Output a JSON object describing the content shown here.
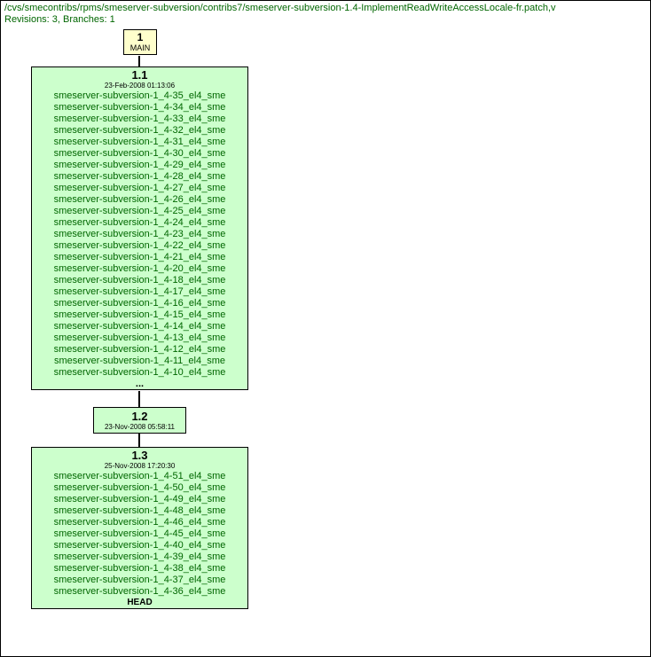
{
  "header": {
    "path": "/cvs/smecontribs/rpms/smeserver-subversion/contribs7/smeserver-subversion-1.4-ImplementReadWriteAccessLocale-fr.patch,v",
    "meta": "Revisions: 3, Branches: 1"
  },
  "branch": {
    "num": "1",
    "name": "MAIN"
  },
  "rev1": {
    "num": "1.1",
    "date": "23-Feb-2008 01:13:06",
    "tags": [
      "smeserver-subversion-1_4-35_el4_sme",
      "smeserver-subversion-1_4-34_el4_sme",
      "smeserver-subversion-1_4-33_el4_sme",
      "smeserver-subversion-1_4-32_el4_sme",
      "smeserver-subversion-1_4-31_el4_sme",
      "smeserver-subversion-1_4-30_el4_sme",
      "smeserver-subversion-1_4-29_el4_sme",
      "smeserver-subversion-1_4-28_el4_sme",
      "smeserver-subversion-1_4-27_el4_sme",
      "smeserver-subversion-1_4-26_el4_sme",
      "smeserver-subversion-1_4-25_el4_sme",
      "smeserver-subversion-1_4-24_el4_sme",
      "smeserver-subversion-1_4-23_el4_sme",
      "smeserver-subversion-1_4-22_el4_sme",
      "smeserver-subversion-1_4-21_el4_sme",
      "smeserver-subversion-1_4-20_el4_sme",
      "smeserver-subversion-1_4-18_el4_sme",
      "smeserver-subversion-1_4-17_el4_sme",
      "smeserver-subversion-1_4-16_el4_sme",
      "smeserver-subversion-1_4-15_el4_sme",
      "smeserver-subversion-1_4-14_el4_sme",
      "smeserver-subversion-1_4-13_el4_sme",
      "smeserver-subversion-1_4-12_el4_sme",
      "smeserver-subversion-1_4-11_el4_sme",
      "smeserver-subversion-1_4-10_el4_sme"
    ],
    "ellipsis": "..."
  },
  "rev2": {
    "num": "1.2",
    "date": "23-Nov-2008 05:58:11"
  },
  "rev3": {
    "num": "1.3",
    "date": "25-Nov-2008 17:20:30",
    "tags": [
      "smeserver-subversion-1_4-51_el4_sme",
      "smeserver-subversion-1_4-50_el4_sme",
      "smeserver-subversion-1_4-49_el4_sme",
      "smeserver-subversion-1_4-48_el4_sme",
      "smeserver-subversion-1_4-46_el4_sme",
      "smeserver-subversion-1_4-45_el4_sme",
      "smeserver-subversion-1_4-40_el4_sme",
      "smeserver-subversion-1_4-39_el4_sme",
      "smeserver-subversion-1_4-38_el4_sme",
      "smeserver-subversion-1_4-37_el4_sme",
      "smeserver-subversion-1_4-36_el4_sme"
    ],
    "head": "HEAD"
  }
}
